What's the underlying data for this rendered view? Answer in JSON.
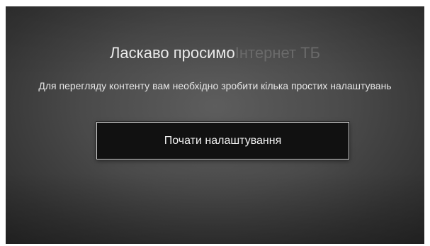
{
  "welcome": {
    "lead": "Ласкаво просимо",
    "app_name": "Інтернет ТБ"
  },
  "subtitle": "Для перегляду контенту вам необхідно зробити кілька простих налаштувань",
  "start_button_label": "Почати налаштування"
}
